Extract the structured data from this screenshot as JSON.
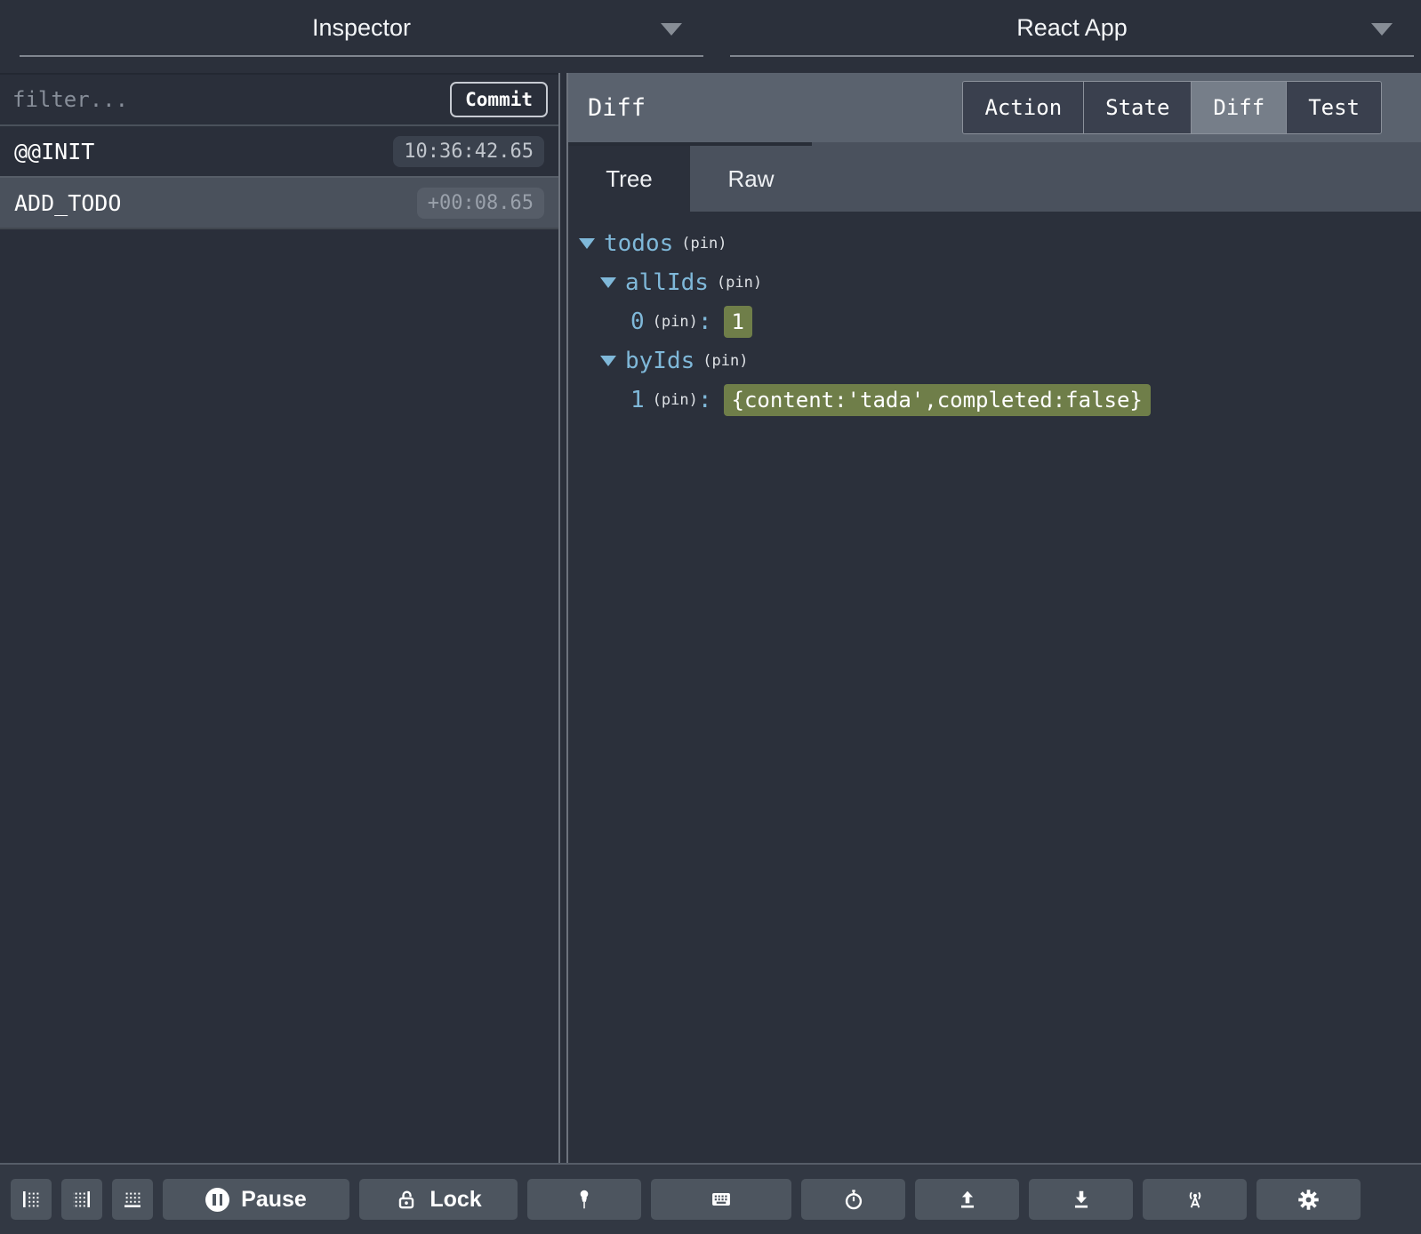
{
  "window": {
    "left_header": {
      "title": "Inspector"
    },
    "right_header": {
      "title": "React App"
    }
  },
  "inspector": {
    "filter": {
      "placeholder": "filter..."
    },
    "commit_button": "Commit",
    "actions": [
      {
        "name": "@@INIT",
        "time": "10:36:42.65",
        "selected": false
      },
      {
        "name": "ADD_TODO",
        "time": "+00:08.65",
        "selected": true
      }
    ]
  },
  "panel": {
    "title": "Diff",
    "tabs": {
      "action": "Action",
      "state": "State",
      "diff": "Diff",
      "test": "Test",
      "active": "Diff"
    },
    "view_tabs": {
      "tree": "Tree",
      "raw": "Raw",
      "active": "Tree"
    }
  },
  "diff_tree": {
    "rows": [
      {
        "level": 0,
        "expanded": true,
        "key": "todos",
        "pin": "(pin)"
      },
      {
        "level": 1,
        "expanded": true,
        "key": "allIds",
        "pin": "(pin)"
      },
      {
        "level": 2,
        "expanded": false,
        "key": "0",
        "pin": "(pin)",
        "colon": ":",
        "value": "1"
      },
      {
        "level": 1,
        "expanded": true,
        "key": "byIds",
        "pin": "(pin)"
      },
      {
        "level": 2,
        "expanded": false,
        "key": "1",
        "pin": "(pin)",
        "colon": ":",
        "value": "{content:'tada',completed:false}"
      }
    ]
  },
  "toolbar": {
    "buttons": [
      {
        "icon": "dock-left-icon"
      },
      {
        "icon": "dock-right-icon"
      },
      {
        "icon": "dock-bottom-icon"
      },
      {
        "icon": "pause-icon",
        "label": "Pause"
      },
      {
        "icon": "lock-icon",
        "label": "Lock"
      },
      {
        "icon": "pin-icon"
      },
      {
        "icon": "keyboard-icon"
      },
      {
        "icon": "stopwatch-icon"
      },
      {
        "icon": "upload-icon"
      },
      {
        "icon": "download-icon"
      },
      {
        "icon": "broadcast-icon"
      },
      {
        "icon": "settings-icon"
      }
    ]
  },
  "colors": {
    "background": "#2b303b",
    "panel_header": "#5a626e",
    "selected_row": "#4a515c",
    "accent_blue": "#7fb8d9",
    "diff_added_badge": "#6f7e49"
  }
}
